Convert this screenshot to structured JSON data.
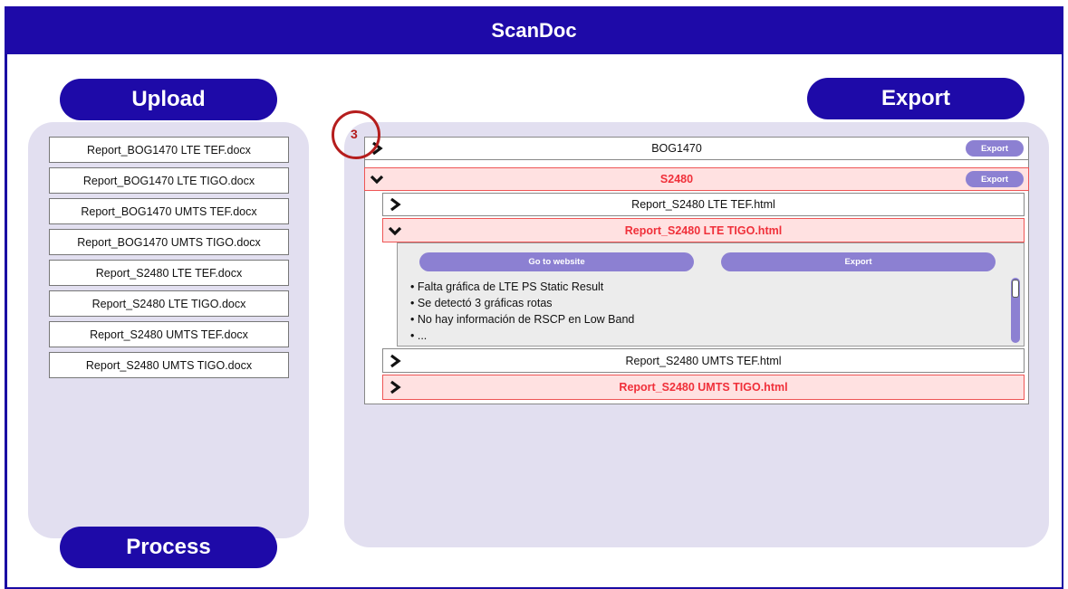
{
  "app": {
    "title": "ScanDoc"
  },
  "buttons": {
    "upload": "Upload",
    "export": "Export",
    "process": "Process"
  },
  "files": [
    "Report_BOG1470 LTE TEF.docx",
    "Report_BOG1470 LTE TIGO.docx",
    "Report_BOG1470 UMTS TEF.docx",
    "Report_BOG1470 UMTS TIGO.docx",
    "Report_S2480 LTE TEF.docx",
    "Report_S2480 LTE TIGO.docx",
    "Report_S2480 UMTS TEF.docx",
    "Report_S2480 UMTS TIGO.docx"
  ],
  "tree": {
    "badge": "3",
    "sites": [
      {
        "name": "BOG1470",
        "export_label": "Export",
        "expanded": false
      },
      {
        "name": "S2480",
        "export_label": "Export",
        "expanded": true
      }
    ],
    "reports": [
      "Report_S2480 LTE TEF.html",
      "Report_S2480 LTE TIGO.html",
      "Report_S2480 UMTS TEF.html",
      "Report_S2480 UMTS TIGO.html"
    ],
    "detail": {
      "website_label": "Go to website",
      "export_label": "Export",
      "issues": [
        "Falta gráfica de LTE PS Static Result",
        "Se detectó 3 gráficas rotas",
        "No hay información de RSCP en Low Band",
        "..."
      ]
    }
  },
  "colors": {
    "primary": "#1e0aa8",
    "accent": "#8c80d2",
    "panel": "#e2dff0",
    "highlight": "#f0303a",
    "highlight_bg": "#ffe1e1"
  }
}
